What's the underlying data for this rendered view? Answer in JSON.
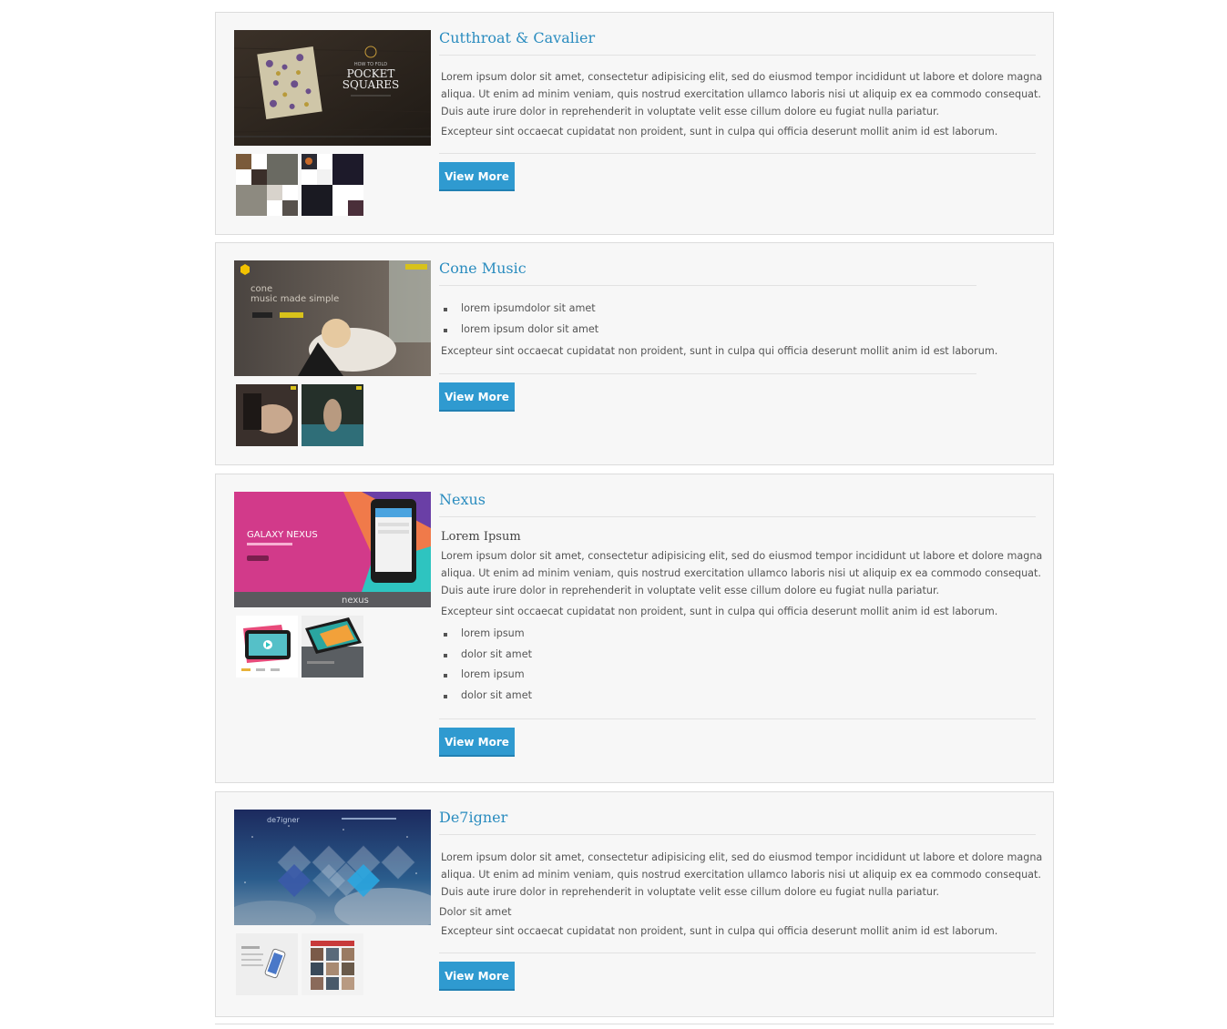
{
  "projects": [
    {
      "title": "Cutthroat & Cavalier",
      "paragraphs": [
        "Lorem ipsum dolor sit amet, consectetur adipisicing elit, sed do eiusmod tempor incididunt ut labore et dolore magna",
        "aliqua. Ut enim ad minim veniam, quis nostrud exercitation ullamco laboris nisi ut aliquip ex ea commodo consequat.",
        "Duis aute irure dolor in reprehenderit in voluptate velit esse cillum dolore eu fugiat nulla pariatur.",
        "Excepteur sint occaecat cupidatat non proident, sunt in culpa qui officia deserunt mollit anim id est laborum."
      ],
      "hero_text": [
        "HOW TO FOLD",
        "POCKET",
        "SQUARES"
      ],
      "button": "View More"
    },
    {
      "title": "Cone Music",
      "bullets": [
        "lorem ipsumdolor sit amet",
        "lorem ipsum dolor sit amet"
      ],
      "paragraph": "Excepteur sint occaecat cupidatat non proident, sunt in culpa qui officia deserunt mollit anim id est laborum.",
      "hero_text": [
        "cone",
        "music made simple"
      ],
      "button": "View More"
    },
    {
      "title": "Nexus",
      "subhead": "Lorem Ipsum",
      "paragraphs": [
        "Lorem ipsum dolor sit amet, consectetur adipisicing elit, sed do eiusmod tempor incididunt ut labore et dolore magna",
        "aliqua. Ut enim ad minim veniam, quis nostrud exercitation ullamco laboris nisi ut aliquip ex ea commodo consequat.",
        "Duis aute irure dolor in reprehenderit in voluptate velit esse cillum dolore eu fugiat nulla pariatur.",
        "Excepteur sint occaecat cupidatat non proident, sunt in culpa qui officia deserunt mollit anim id est laborum."
      ],
      "bullets": [
        "lorem ipsum",
        "dolor sit amet",
        "lorem ipsum",
        "dolor sit amet"
      ],
      "hero_text": [
        "GALAXY NEXUS",
        "nexus"
      ],
      "button": "View More"
    },
    {
      "title": "De7igner",
      "paragraphs": [
        "Lorem ipsum dolor sit amet, consectetur adipisicing elit, sed do eiusmod tempor incididunt ut labore et dolore magna",
        "aliqua. Ut enim ad minim veniam, quis nostrud exercitation ullamco laboris nisi ut aliquip ex ea commodo consequat.",
        "Duis aute irure dolor in reprehenderit in voluptate velit esse cillum dolore eu fugiat nulla pariatur.",
        "Dolor sit amet",
        "Excepteur sint occaecat cupidatat non proident, sunt in culpa qui officia deserunt mollit anim id est laborum."
      ],
      "hero_text": [
        "de7igner"
      ],
      "button": "View More"
    }
  ],
  "colors": {
    "accent": "#2f9ad0",
    "title": "#2a8cbf",
    "card_bg": "#f7f7f7",
    "border": "#dcdcdc"
  }
}
